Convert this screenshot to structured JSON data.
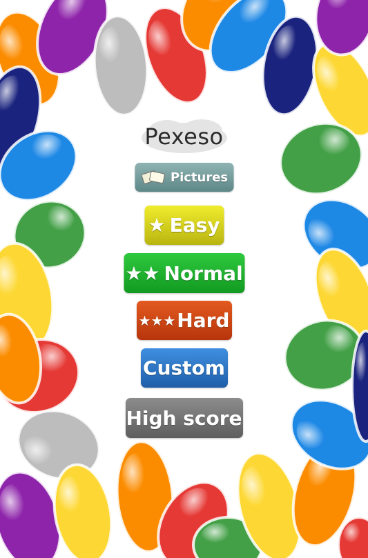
{
  "app": {
    "title": "Pexeso"
  },
  "buttons": {
    "pictures": {
      "label": "Pictures",
      "color": "#7a9e9e"
    },
    "easy": {
      "stars": "★",
      "label": "Easy",
      "color": "#d9d21c"
    },
    "normal": {
      "stars": "★★",
      "label": "Normal",
      "color": "#1db52e"
    },
    "hard": {
      "stars": "★★★",
      "label": "Hard",
      "color": "#d3461a"
    },
    "custom": {
      "label": "Custom",
      "color": "#2d78c8"
    },
    "highscore": {
      "label": "High score",
      "color": "#777777"
    }
  },
  "decoration": {
    "petal_colors": [
      "#e53935",
      "#fdd835",
      "#1e88e5",
      "#43a047",
      "#fb8c00",
      "#8e24aa",
      "#bdbdbd",
      "#1a237e"
    ]
  }
}
